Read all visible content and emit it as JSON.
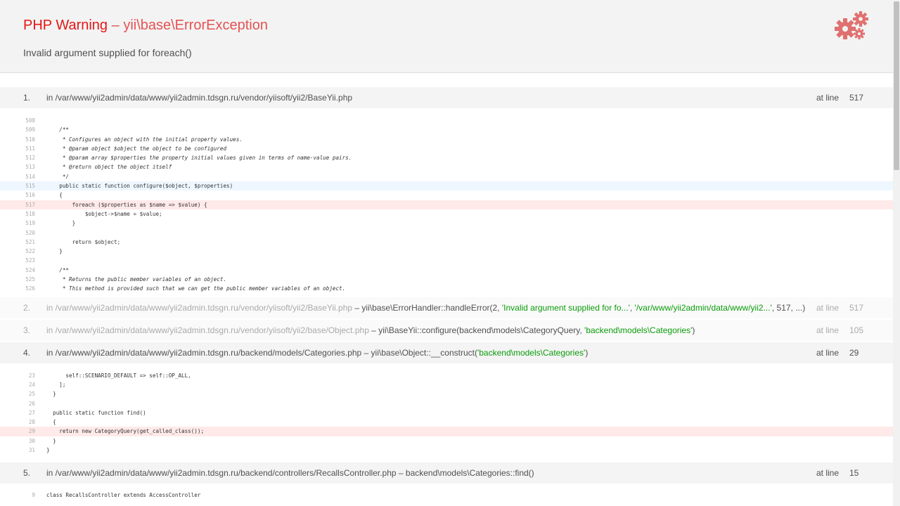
{
  "header": {
    "title_php": "PHP Warning",
    "title_sep": " – ",
    "title_exception": "yii\\base\\ErrorException",
    "message": "Invalid argument supplied for foreach()",
    "icon": "gears-icon",
    "accent_color": "#e51717"
  },
  "frames": [
    {
      "number": "1.",
      "file": "in /var/www/yii2admin/data/www/yii2admin.tdsgn.ru/vendor/yiisoft/yii2/BaseYii.php",
      "at_line_label": "at line",
      "line": "517",
      "code": [
        {
          "n": "508",
          "t": ""
        },
        {
          "n": "509",
          "t": "    /**"
        },
        {
          "n": "510",
          "t": "     * Configures an object with the initial property values."
        },
        {
          "n": "511",
          "t": "     * @param object $object the object to be configured"
        },
        {
          "n": "512",
          "t": "     * @param array $properties the property initial values given in terms of name-value pairs."
        },
        {
          "n": "513",
          "t": "     * @return object the object itself"
        },
        {
          "n": "514",
          "t": "     */"
        },
        {
          "n": "515",
          "t": "    public static function configure($object, $properties)"
        },
        {
          "n": "516",
          "t": "    {"
        },
        {
          "n": "517",
          "t": "        foreach ($properties as $name => $value) {"
        },
        {
          "n": "518",
          "t": "            $object->$name = $value;"
        },
        {
          "n": "519",
          "t": "        }"
        },
        {
          "n": "520",
          "t": ""
        },
        {
          "n": "521",
          "t": "        return $object;"
        },
        {
          "n": "522",
          "t": "    }"
        },
        {
          "n": "523",
          "t": ""
        },
        {
          "n": "524",
          "t": "    /**"
        },
        {
          "n": "525",
          "t": "     * Returns the public member variables of an object."
        },
        {
          "n": "526",
          "t": "     * This method is provided such that we can get the public member variables of an object."
        }
      ]
    },
    {
      "number": "2.",
      "file": "in /var/www/yii2admin/data/www/yii2admin.tdsgn.ru/vendor/yiisoft/yii2/BaseYii.php",
      "call_prefix": " – yii\\base\\ErrorHandler::handleError(2, ",
      "arg1": "'Invalid argument supplied for fo...'",
      "sep1": ", ",
      "arg2": "'/var/www/yii2admin/data/www/yii2...'",
      "sep2": ", ",
      "arg3": "517",
      "call_suffix": ", ...)",
      "at_line_label": "at line",
      "line": "517"
    },
    {
      "number": "3.",
      "file": "in /var/www/yii2admin/data/www/yii2admin.tdsgn.ru/vendor/yiisoft/yii2/base/Object.php",
      "call_prefix": " – yii\\BaseYii::configure(backend\\models\\CategoryQuery, ",
      "arg1": "'backend\\models\\Categories'",
      "call_suffix": ")",
      "at_line_label": "at line",
      "line": "105"
    },
    {
      "number": "4.",
      "file": "in /var/www/yii2admin/data/www/yii2admin.tdsgn.ru/backend/models/Categories.php",
      "call_prefix": " – yii\\base\\Object::__construct(",
      "arg1": "'backend\\models\\Categories'",
      "call_suffix": ")",
      "at_line_label": "at line",
      "line": "29",
      "code": [
        {
          "n": "23",
          "t": "      self::SCENARIO_DEFAULT => self::OP_ALL,"
        },
        {
          "n": "24",
          "t": "    ];"
        },
        {
          "n": "25",
          "t": "  }"
        },
        {
          "n": "26",
          "t": ""
        },
        {
          "n": "27",
          "t": "  public static function find()"
        },
        {
          "n": "28",
          "t": "  {"
        },
        {
          "n": "29",
          "t": "    return new CategoryQuery(get_called_class());"
        },
        {
          "n": "30",
          "t": "  }"
        },
        {
          "n": "31",
          "t": "}"
        }
      ]
    },
    {
      "number": "5.",
      "file": "in /var/www/yii2admin/data/www/yii2admin.tdsgn.ru/backend/controllers/RecallsController.php",
      "call_prefix": " – backend\\models\\Categories::find()",
      "at_line_label": "at line",
      "line": "15",
      "code": [
        {
          "n": "9",
          "t": "class RecallsController extends AccessController"
        }
      ]
    }
  ]
}
